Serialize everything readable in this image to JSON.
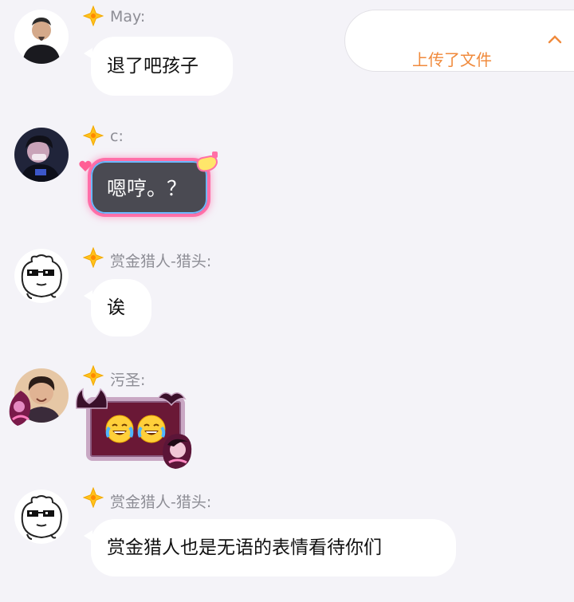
{
  "upload_notice": {
    "label": "上传了文件",
    "icon": "chevron-up-icon"
  },
  "colors": {
    "background": "#f4f3f8",
    "bubble": "#ffffff",
    "name_text": "#8d8d95",
    "accent_orange": "#f08a3c",
    "badge_gold": "#ffc21c"
  },
  "messages": [
    {
      "sender": "May:",
      "text": "退了吧孩子",
      "avatar": "avatar-photo-icon",
      "badge": "star-badge-icon",
      "bubble_style": "plain"
    },
    {
      "sender": "c:",
      "text": "嗯哼。？",
      "avatar": "avatar-photo-icon",
      "badge": "star-badge-icon",
      "bubble_style": "neon"
    },
    {
      "sender": "赏金猎人-猎头:",
      "text": "诶",
      "avatar": "sunglasses-bear-icon",
      "badge": "star-badge-icon",
      "bubble_style": "plain"
    },
    {
      "sender": "污圣:",
      "text": "😂😂",
      "avatar": "avatar-photo-icon",
      "badge": "star-badge-icon",
      "bubble_style": "fancy-frame"
    },
    {
      "sender": "赏金猎人-猎头:",
      "text": "赏金猎人也是无语的表情看待你们",
      "avatar": "sunglasses-bear-icon",
      "badge": "star-badge-icon",
      "bubble_style": "plain"
    }
  ]
}
